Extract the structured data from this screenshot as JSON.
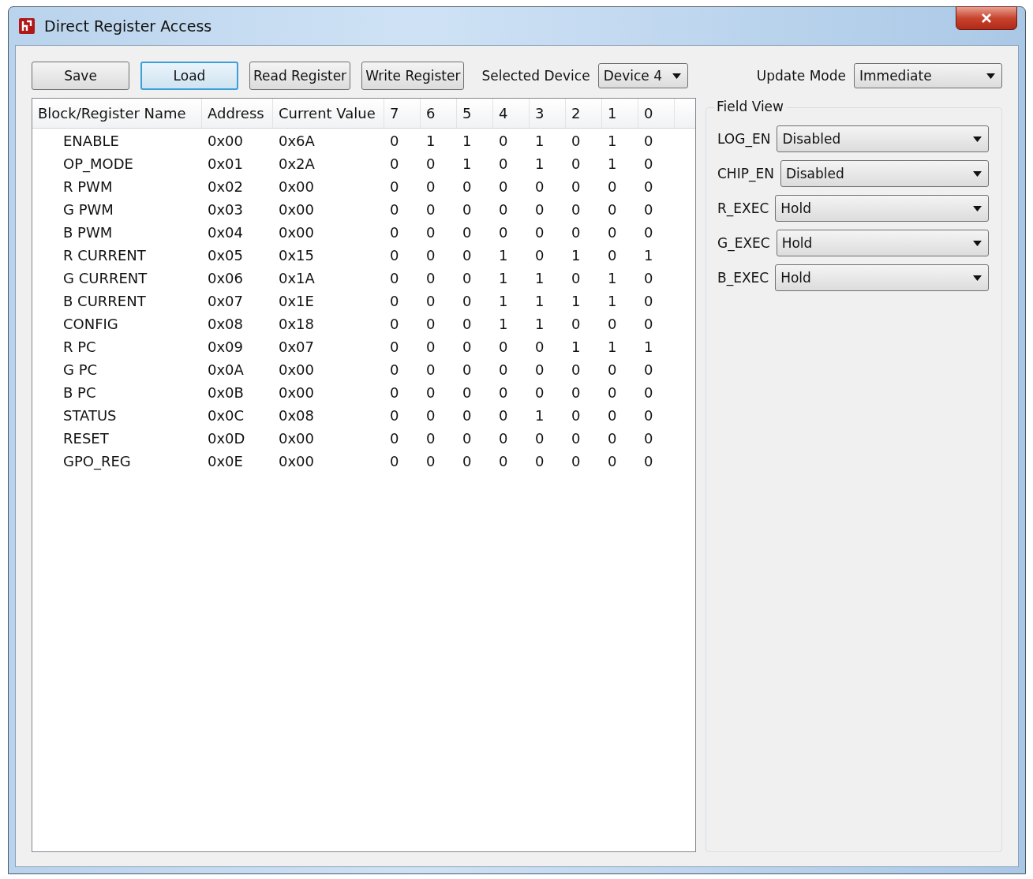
{
  "window": {
    "title": "Direct Register Access"
  },
  "toolbar": {
    "buttons": [
      {
        "label": "Save",
        "focused": false
      },
      {
        "label": "Load",
        "focused": true
      },
      {
        "label": "Read Register",
        "focused": false
      },
      {
        "label": "Write Register",
        "focused": false
      }
    ],
    "device_label": "Selected Device",
    "device": "Device 4",
    "update_label": "Update Mode",
    "update_mode": "Immediate"
  },
  "table": {
    "columns": [
      "Block/Register Name",
      "Address",
      "Current Value",
      "7",
      "6",
      "5",
      "4",
      "3",
      "2",
      "1",
      "0"
    ],
    "rows": [
      {
        "name": "ENABLE",
        "address": "0x00",
        "value": "0x6A",
        "bits": [
          "0",
          "1",
          "1",
          "0",
          "1",
          "0",
          "1",
          "0"
        ]
      },
      {
        "name": "OP_MODE",
        "address": "0x01",
        "value": "0x2A",
        "bits": [
          "0",
          "0",
          "1",
          "0",
          "1",
          "0",
          "1",
          "0"
        ]
      },
      {
        "name": "R PWM",
        "address": "0x02",
        "value": "0x00",
        "bits": [
          "0",
          "0",
          "0",
          "0",
          "0",
          "0",
          "0",
          "0"
        ]
      },
      {
        "name": "G PWM",
        "address": "0x03",
        "value": "0x00",
        "bits": [
          "0",
          "0",
          "0",
          "0",
          "0",
          "0",
          "0",
          "0"
        ]
      },
      {
        "name": "B PWM",
        "address": "0x04",
        "value": "0x00",
        "bits": [
          "0",
          "0",
          "0",
          "0",
          "0",
          "0",
          "0",
          "0"
        ]
      },
      {
        "name": "R CURRENT",
        "address": "0x05",
        "value": "0x15",
        "bits": [
          "0",
          "0",
          "0",
          "1",
          "0",
          "1",
          "0",
          "1"
        ]
      },
      {
        "name": "G CURRENT",
        "address": "0x06",
        "value": "0x1A",
        "bits": [
          "0",
          "0",
          "0",
          "1",
          "1",
          "0",
          "1",
          "0"
        ]
      },
      {
        "name": "B CURRENT",
        "address": "0x07",
        "value": "0x1E",
        "bits": [
          "0",
          "0",
          "0",
          "1",
          "1",
          "1",
          "1",
          "0"
        ]
      },
      {
        "name": "CONFIG",
        "address": "0x08",
        "value": "0x18",
        "bits": [
          "0",
          "0",
          "0",
          "1",
          "1",
          "0",
          "0",
          "0"
        ]
      },
      {
        "name": "R PC",
        "address": "0x09",
        "value": "0x07",
        "bits": [
          "0",
          "0",
          "0",
          "0",
          "0",
          "1",
          "1",
          "1"
        ]
      },
      {
        "name": "G PC",
        "address": "0x0A",
        "value": "0x00",
        "bits": [
          "0",
          "0",
          "0",
          "0",
          "0",
          "0",
          "0",
          "0"
        ]
      },
      {
        "name": "B PC",
        "address": "0x0B",
        "value": "0x00",
        "bits": [
          "0",
          "0",
          "0",
          "0",
          "0",
          "0",
          "0",
          "0"
        ]
      },
      {
        "name": "STATUS",
        "address": "0x0C",
        "value": "0x08",
        "bits": [
          "0",
          "0",
          "0",
          "0",
          "1",
          "0",
          "0",
          "0"
        ]
      },
      {
        "name": "RESET",
        "address": "0x0D",
        "value": "0x00",
        "bits": [
          "0",
          "0",
          "0",
          "0",
          "0",
          "0",
          "0",
          "0"
        ]
      },
      {
        "name": "GPO_REG",
        "address": "0x0E",
        "value": "0x00",
        "bits": [
          "0",
          "0",
          "0",
          "0",
          "0",
          "0",
          "0",
          "0"
        ]
      }
    ]
  },
  "field_view": {
    "title": "Field View",
    "fields": [
      {
        "label": "LOG_EN",
        "value": "Disabled"
      },
      {
        "label": "CHIP_EN",
        "value": "Disabled"
      },
      {
        "label": "R_EXEC",
        "value": "Hold"
      },
      {
        "label": "G_EXEC",
        "value": "Hold"
      },
      {
        "label": "B_EXEC",
        "value": "Hold"
      }
    ]
  }
}
